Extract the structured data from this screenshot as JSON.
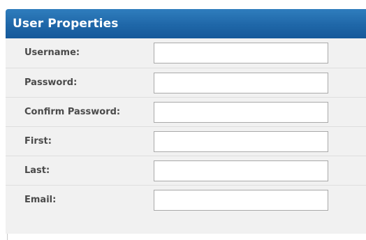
{
  "panel": {
    "title": "User Properties"
  },
  "form": {
    "fields": [
      {
        "label": "Username:",
        "value": "",
        "placeholder": ""
      },
      {
        "label": "Password:",
        "value": "",
        "placeholder": ""
      },
      {
        "label": "Confirm Password:",
        "value": "",
        "placeholder": ""
      },
      {
        "label": "First:",
        "value": "",
        "placeholder": ""
      },
      {
        "label": "Last:",
        "value": "",
        "placeholder": ""
      },
      {
        "label": "Email:",
        "value": "",
        "placeholder": ""
      }
    ]
  },
  "colors": {
    "header_blue": "#1f67a8",
    "form_background": "#f1f1f1",
    "label_text": "#4a4a4a"
  }
}
